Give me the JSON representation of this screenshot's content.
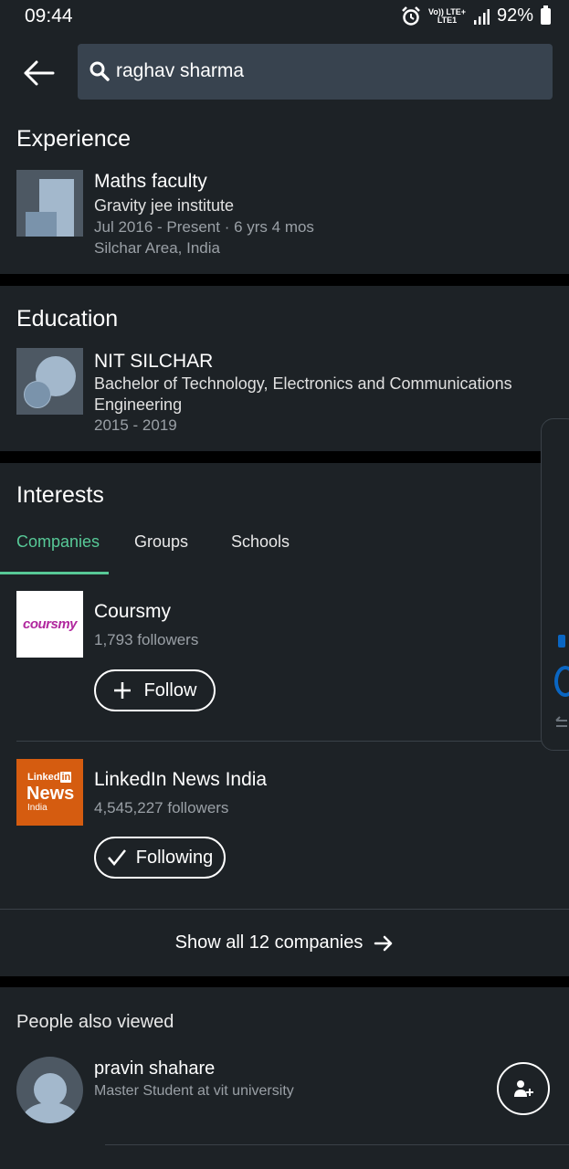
{
  "status": {
    "time": "09:44",
    "network_top": "Vo)) LTE+",
    "network_bottom": "LTE1",
    "battery": "92%"
  },
  "search": {
    "query": "raghav sharma"
  },
  "experience": {
    "heading": "Experience",
    "title": "Maths faculty",
    "company": "Gravity jee institute",
    "dates": "Jul 2016 - Present · 6 yrs 4 mos",
    "location": "Silchar Area, India"
  },
  "education": {
    "heading": "Education",
    "school": "NIT SILCHAR",
    "degree_line1": "Bachelor of Technology, Electronics and Communications",
    "degree_line2": "Engineering",
    "years": "2015 - 2019"
  },
  "interests": {
    "heading": "Interests",
    "tabs": [
      {
        "label": "Companies",
        "active": true
      },
      {
        "label": "Groups"
      },
      {
        "label": "Schools"
      }
    ],
    "companies": [
      {
        "name": "Coursmy",
        "logo_text": "coursmy",
        "followers": "1,793 followers",
        "button": "Follow"
      },
      {
        "name": "LinkedIn News India",
        "logo_top": "Linked",
        "logo_in": "in",
        "logo_mid": "News",
        "logo_bottom": "India",
        "followers": "4,545,227 followers",
        "button": "Following"
      }
    ],
    "show_all": "Show all 12 companies"
  },
  "people": {
    "heading": "People also viewed",
    "items": [
      {
        "name": "pravin shahare",
        "headline": "Master Student at vit university"
      }
    ]
  },
  "colors": {
    "accent_green": "#57c997",
    "background": "#1d2226",
    "search_bg": "#38434f",
    "linkedin_orange": "#d55c10",
    "coursmy_purple": "#b1289e"
  }
}
